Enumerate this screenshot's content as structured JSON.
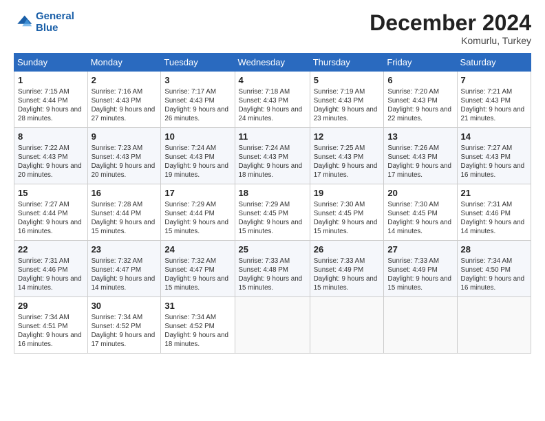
{
  "header": {
    "logo_line1": "General",
    "logo_line2": "Blue",
    "month": "December 2024",
    "location": "Komurlu, Turkey"
  },
  "days_of_week": [
    "Sunday",
    "Monday",
    "Tuesday",
    "Wednesday",
    "Thursday",
    "Friday",
    "Saturday"
  ],
  "weeks": [
    [
      {
        "day": "1",
        "text": "Sunrise: 7:15 AM\nSunset: 4:44 PM\nDaylight: 9 hours and 28 minutes."
      },
      {
        "day": "2",
        "text": "Sunrise: 7:16 AM\nSunset: 4:43 PM\nDaylight: 9 hours and 27 minutes."
      },
      {
        "day": "3",
        "text": "Sunrise: 7:17 AM\nSunset: 4:43 PM\nDaylight: 9 hours and 26 minutes."
      },
      {
        "day": "4",
        "text": "Sunrise: 7:18 AM\nSunset: 4:43 PM\nDaylight: 9 hours and 24 minutes."
      },
      {
        "day": "5",
        "text": "Sunrise: 7:19 AM\nSunset: 4:43 PM\nDaylight: 9 hours and 23 minutes."
      },
      {
        "day": "6",
        "text": "Sunrise: 7:20 AM\nSunset: 4:43 PM\nDaylight: 9 hours and 22 minutes."
      },
      {
        "day": "7",
        "text": "Sunrise: 7:21 AM\nSunset: 4:43 PM\nDaylight: 9 hours and 21 minutes."
      }
    ],
    [
      {
        "day": "8",
        "text": "Sunrise: 7:22 AM\nSunset: 4:43 PM\nDaylight: 9 hours and 20 minutes."
      },
      {
        "day": "9",
        "text": "Sunrise: 7:23 AM\nSunset: 4:43 PM\nDaylight: 9 hours and 20 minutes."
      },
      {
        "day": "10",
        "text": "Sunrise: 7:24 AM\nSunset: 4:43 PM\nDaylight: 9 hours and 19 minutes."
      },
      {
        "day": "11",
        "text": "Sunrise: 7:24 AM\nSunset: 4:43 PM\nDaylight: 9 hours and 18 minutes."
      },
      {
        "day": "12",
        "text": "Sunrise: 7:25 AM\nSunset: 4:43 PM\nDaylight: 9 hours and 17 minutes."
      },
      {
        "day": "13",
        "text": "Sunrise: 7:26 AM\nSunset: 4:43 PM\nDaylight: 9 hours and 17 minutes."
      },
      {
        "day": "14",
        "text": "Sunrise: 7:27 AM\nSunset: 4:43 PM\nDaylight: 9 hours and 16 minutes."
      }
    ],
    [
      {
        "day": "15",
        "text": "Sunrise: 7:27 AM\nSunset: 4:44 PM\nDaylight: 9 hours and 16 minutes."
      },
      {
        "day": "16",
        "text": "Sunrise: 7:28 AM\nSunset: 4:44 PM\nDaylight: 9 hours and 15 minutes."
      },
      {
        "day": "17",
        "text": "Sunrise: 7:29 AM\nSunset: 4:44 PM\nDaylight: 9 hours and 15 minutes."
      },
      {
        "day": "18",
        "text": "Sunrise: 7:29 AM\nSunset: 4:45 PM\nDaylight: 9 hours and 15 minutes."
      },
      {
        "day": "19",
        "text": "Sunrise: 7:30 AM\nSunset: 4:45 PM\nDaylight: 9 hours and 15 minutes."
      },
      {
        "day": "20",
        "text": "Sunrise: 7:30 AM\nSunset: 4:45 PM\nDaylight: 9 hours and 14 minutes."
      },
      {
        "day": "21",
        "text": "Sunrise: 7:31 AM\nSunset: 4:46 PM\nDaylight: 9 hours and 14 minutes."
      }
    ],
    [
      {
        "day": "22",
        "text": "Sunrise: 7:31 AM\nSunset: 4:46 PM\nDaylight: 9 hours and 14 minutes."
      },
      {
        "day": "23",
        "text": "Sunrise: 7:32 AM\nSunset: 4:47 PM\nDaylight: 9 hours and 14 minutes."
      },
      {
        "day": "24",
        "text": "Sunrise: 7:32 AM\nSunset: 4:47 PM\nDaylight: 9 hours and 15 minutes."
      },
      {
        "day": "25",
        "text": "Sunrise: 7:33 AM\nSunset: 4:48 PM\nDaylight: 9 hours and 15 minutes."
      },
      {
        "day": "26",
        "text": "Sunrise: 7:33 AM\nSunset: 4:49 PM\nDaylight: 9 hours and 15 minutes."
      },
      {
        "day": "27",
        "text": "Sunrise: 7:33 AM\nSunset: 4:49 PM\nDaylight: 9 hours and 15 minutes."
      },
      {
        "day": "28",
        "text": "Sunrise: 7:34 AM\nSunset: 4:50 PM\nDaylight: 9 hours and 16 minutes."
      }
    ],
    [
      {
        "day": "29",
        "text": "Sunrise: 7:34 AM\nSunset: 4:51 PM\nDaylight: 9 hours and 16 minutes."
      },
      {
        "day": "30",
        "text": "Sunrise: 7:34 AM\nSunset: 4:52 PM\nDaylight: 9 hours and 17 minutes."
      },
      {
        "day": "31",
        "text": "Sunrise: 7:34 AM\nSunset: 4:52 PM\nDaylight: 9 hours and 18 minutes."
      },
      null,
      null,
      null,
      null
    ]
  ]
}
